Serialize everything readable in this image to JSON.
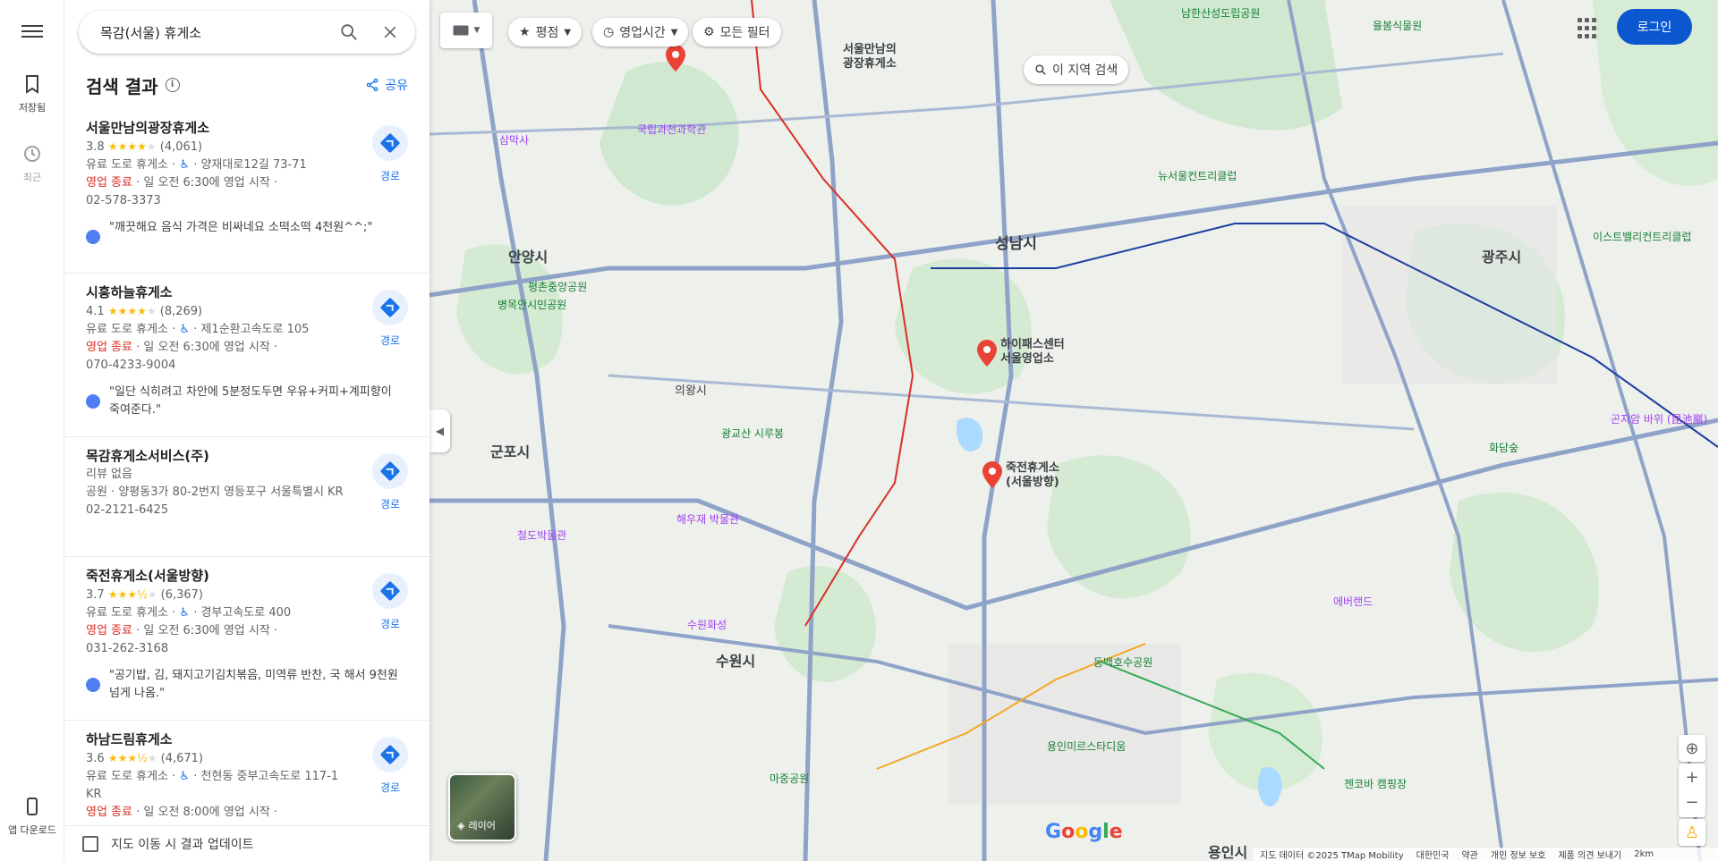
{
  "rail": {
    "saved_label": "저장됨",
    "recent_label": "최근",
    "app_download_label": "앱 다운로드"
  },
  "search": {
    "query": "목감(서울) 휴게소"
  },
  "results": {
    "title": "검색 결과",
    "share_label": "공유",
    "route_label": "경로",
    "items": [
      {
        "name": "서울만남의광장휴게소",
        "rating": "3.8",
        "stars": 4,
        "reviews": "(4,061)",
        "category": "유료 도로 휴게소",
        "address": "양재대로12길 73-71",
        "status": "영업 종료",
        "hours": "일 오전 6:30에 영업 시작",
        "phone": "02-578-3373",
        "review": "\"깨끗해요 음식 가격은 비싸네요 소떡소떡 4천원^^;\""
      },
      {
        "name": "시흥하늘휴게소",
        "rating": "4.1",
        "stars": 4,
        "reviews": "(8,269)",
        "category": "유료 도로 휴게소",
        "address": "제1순환고속도로 105",
        "status": "영업 종료",
        "hours": "일 오전 6:30에 영업 시작",
        "phone": "070-4233-9004",
        "review": "\"일단 식히려고 차안에 5분정도두면 우유+커피+계피향이 죽여준다.\""
      },
      {
        "name": "목감휴게소서비스(주)",
        "no_review": "리뷰 없음",
        "category": "공원",
        "address": "양평동3가 80-2번지 영등포구 서울특별시 KR",
        "phone": "02-2121-6425"
      },
      {
        "name": "죽전휴게소(서울방향)",
        "rating": "3.7",
        "stars": 3.5,
        "reviews": "(6,367)",
        "category": "유료 도로 휴게소",
        "address": "경부고속도로 400",
        "status": "영업 종료",
        "hours": "일 오전 6:30에 영업 시작",
        "phone": "031-262-3168",
        "review": "\"공기밥, 김, 돼지고기김치볶음, 미역류 반찬, 국 해서 9천원 넘게 나옴.\""
      },
      {
        "name": "하남드림휴게소",
        "rating": "3.6",
        "stars": 3.5,
        "reviews": "(4,671)",
        "category": "유료 도로 휴게소",
        "address": "천현동 중부고속도로 117-1 KR",
        "status": "영업 종료",
        "hours": "일 오전 8:00에 영업 시작"
      }
    ],
    "update_label": "지도 이동 시 결과 업데이트"
  },
  "map": {
    "chips": [
      "평점",
      "영업시간",
      "모든 필터"
    ],
    "area_search": "이 지역 검색",
    "login": "로그인",
    "layer_label": "레이어",
    "footer": [
      "지도 데이터 ©2025 TMap Mobility",
      "대한민국",
      "약관",
      "개인 정보 보호",
      "제품 의견 보내기",
      "2km"
    ],
    "markers": [
      {
        "label": "서울만남의\n광장휴게소"
      },
      {
        "label": "하이패스센터\n서울영업소"
      },
      {
        "label": "죽전휴게소\n(서울방향)"
      }
    ],
    "cities": [
      "성남시",
      "안양시",
      "군포시",
      "의왕시",
      "수원시",
      "광주시",
      "용인시"
    ],
    "places": [
      "국립과천과학관",
      "삼막사",
      "평촌중앙공원",
      "병목안시민공원",
      "광교산 시루봉",
      "해우재 박물관",
      "철도박물관",
      "수원화성",
      "뉴서울컨트리클럽",
      "에버랜드",
      "동백호수공원",
      "화담숲",
      "곤지암 바위 (昆池巖)",
      "이스트밸리컨트리클럽",
      "마중공원",
      "용인미르스타디움",
      "젠코바 캠핑장",
      "남한산성도립공원",
      "율봄식물원"
    ]
  }
}
